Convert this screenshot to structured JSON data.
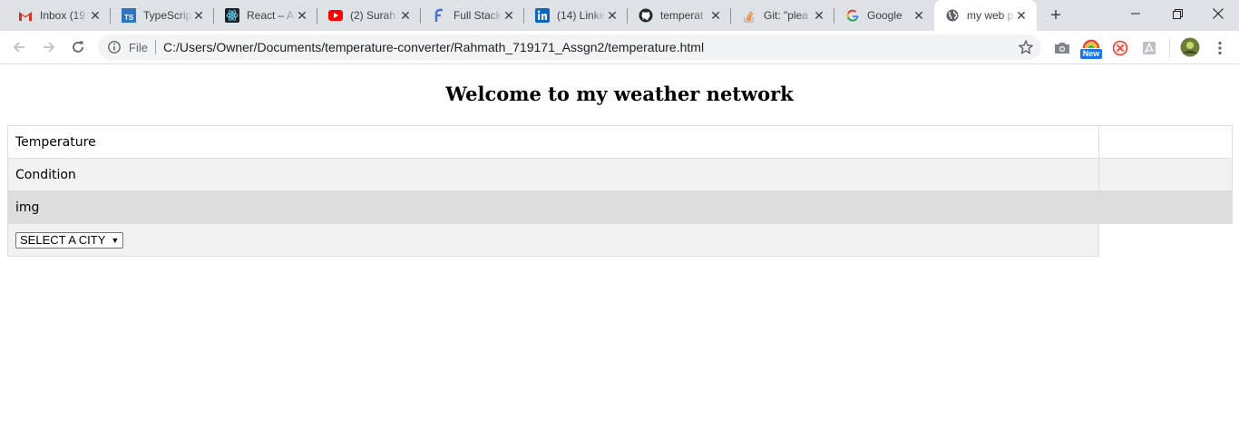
{
  "browser": {
    "tabs": [
      {
        "title": "Inbox (19",
        "icon": "gmail-icon"
      },
      {
        "title": "TypeScrip",
        "icon": "typescript-icon"
      },
      {
        "title": "React – A",
        "icon": "react-icon"
      },
      {
        "title": "(2) Surah",
        "icon": "youtube-icon"
      },
      {
        "title": "Full Stack",
        "icon": "fullstack-icon"
      },
      {
        "title": "(14) Linke",
        "icon": "linkedin-icon"
      },
      {
        "title": "temperat",
        "icon": "github-icon"
      },
      {
        "title": "Git: \"plea",
        "icon": "stackoverflow-icon"
      },
      {
        "title": "Google",
        "icon": "google-icon"
      },
      {
        "title": "my web p",
        "icon": "globe-icon",
        "active": true
      }
    ],
    "new_tab_label": "+",
    "omnibox": {
      "scheme_label": "File",
      "url": "C:/Users/Owner/Documents/temperature-converter/Rahmath_719171_Assgn2/temperature.html"
    },
    "extension_badge": "New",
    "colors": {
      "tabstrip": "#dee1e6",
      "omnibox": "#f1f3f4",
      "badge": "#1a73e8"
    }
  },
  "page": {
    "title": "Welcome to my weather network",
    "rows": [
      {
        "label": "Temperature",
        "value": ""
      },
      {
        "label": "Condition",
        "value": ""
      },
      {
        "label": "img"
      }
    ],
    "city_select": {
      "selected": "SELECT A CITY"
    }
  }
}
